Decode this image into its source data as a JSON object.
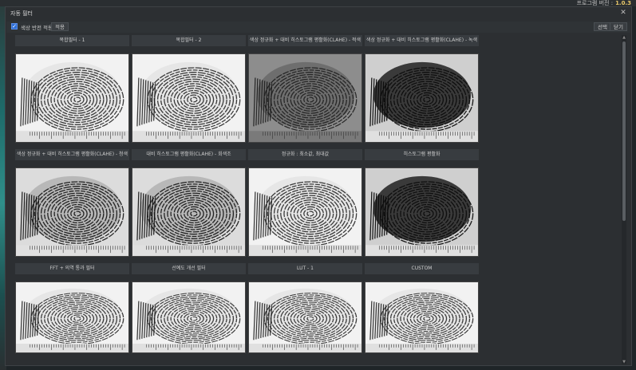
{
  "app": {
    "label": "프로그램 버전 :",
    "version": "1.0.3"
  },
  "window": {
    "title": "자동 필터",
    "close_glyph": "✕"
  },
  "toolbar": {
    "checkbox_label": "색상 반전 적용",
    "apply_label": "적용",
    "select_label": "선택",
    "close_label": "닫기"
  },
  "filters": [
    {
      "label": "복합필터 - 1",
      "style": "light"
    },
    {
      "label": "복합필터 - 2",
      "style": "light"
    },
    {
      "label": "색상 정규화 + 대비 히스토그램 평활화(CLAHE) - 적색",
      "style": "gray"
    },
    {
      "label": "색상 정규화 + 대비 히스토그램 평활화(CLAHE) - 녹색",
      "style": "dark"
    },
    {
      "label": "색상 정규화 + 대비 히스토그램 평활화(CLAHE) - 청색",
      "style": "mid"
    },
    {
      "label": "대비 히스토그램 평활화(CLAHE) - 회색조",
      "style": "mid"
    },
    {
      "label": "정규화 : 최소값, 최대값",
      "style": "light"
    },
    {
      "label": "히스토그램 평활화",
      "style": "dark"
    },
    {
      "label": "FFT + 의역 통과 필터",
      "style": "light"
    },
    {
      "label": "선예도 개선 필터",
      "style": "light"
    },
    {
      "label": "LUT - 1",
      "style": "light"
    },
    {
      "label": "CUSTOM",
      "style": "light"
    }
  ],
  "colors": {
    "accent": "#2f6fd6",
    "version": "#e8c86a"
  },
  "icons": {
    "check": "✓",
    "scroll_up": "▲",
    "scroll_down": "▼"
  }
}
